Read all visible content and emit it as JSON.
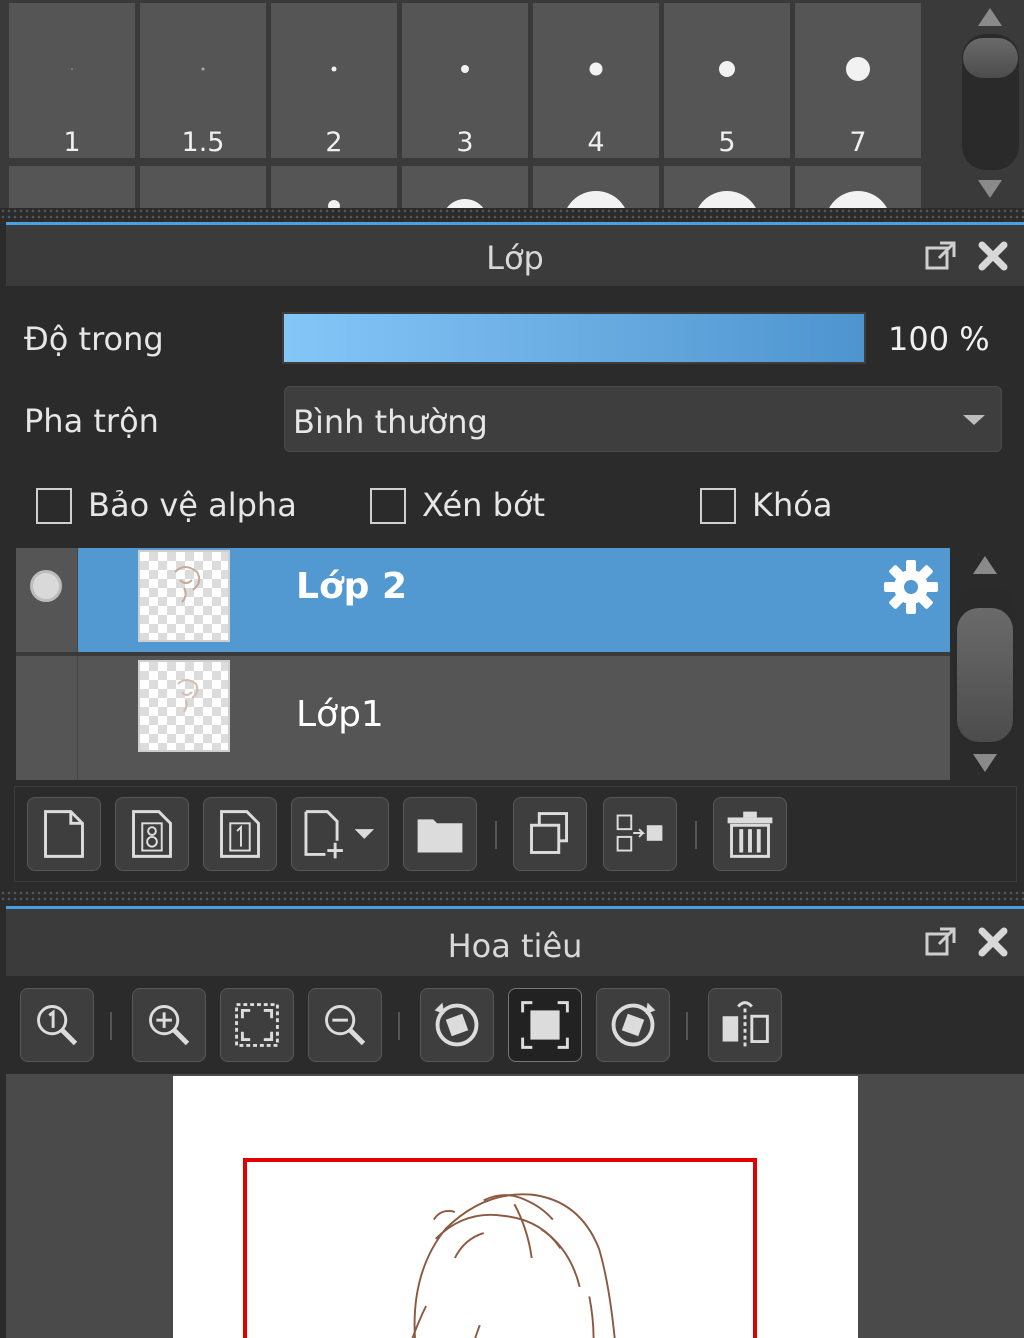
{
  "brush_panel": {
    "sizes": [
      "1",
      "1.5",
      "2",
      "3",
      "4",
      "5",
      "7"
    ]
  },
  "layer_panel": {
    "title": "Lớp",
    "opacity_label": "Độ trong",
    "opacity_value": "100 %",
    "opacity_percent": 100,
    "blend_label": "Pha trộn",
    "blend_value": "Bình thường",
    "checkboxes": {
      "protect_alpha": "Bảo vệ alpha",
      "clipping": "Xén bớt",
      "lock": "Khóa"
    },
    "layers": [
      {
        "name": "Lớp 2",
        "selected": true,
        "visible": true
      },
      {
        "name": "Lớp1",
        "selected": false,
        "visible": false
      }
    ],
    "accent_color": "#5299d2",
    "header_accent": "#4a9fe0"
  },
  "navigator_panel": {
    "title": "Hoa tiêu",
    "viewport_color": "#e00000"
  },
  "icons": {
    "layer_toolbar": [
      "new-layer-icon",
      "new-8bit-layer-icon",
      "new-1bit-layer-icon",
      "add-layer-dropdown-icon",
      "folder-icon",
      "duplicate-layer-icon",
      "merge-layer-icon",
      "trash-icon"
    ],
    "nav_toolbar": [
      "zoom-actual-icon",
      "zoom-in-icon",
      "fit-screen-icon",
      "zoom-out-icon",
      "rotate-left-icon",
      "fit-canvas-icon",
      "rotate-right-icon",
      "flip-horizontal-icon"
    ]
  }
}
